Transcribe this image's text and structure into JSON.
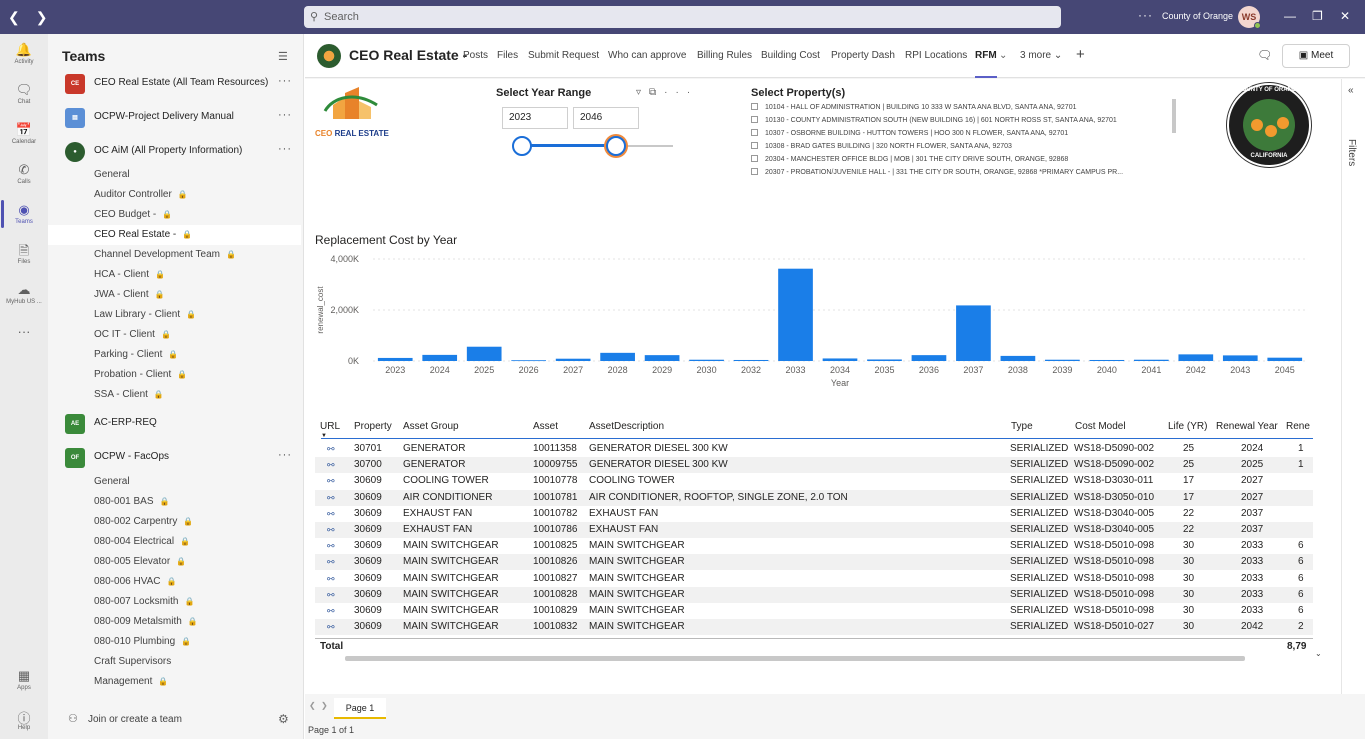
{
  "topbar": {
    "search_placeholder": "Search",
    "org": "County of Orange",
    "avatar_initials": "WS"
  },
  "rail": [
    {
      "label": "Activity",
      "icon": "bell-icon"
    },
    {
      "label": "Chat",
      "icon": "chat-icon"
    },
    {
      "label": "Calendar",
      "icon": "calendar-icon"
    },
    {
      "label": "Calls",
      "icon": "phone-icon"
    },
    {
      "label": "Teams",
      "icon": "teams-icon"
    },
    {
      "label": "Files",
      "icon": "file-icon"
    },
    {
      "label": "MyHub US ...",
      "icon": "cloud-icon"
    },
    {
      "label": "Apps",
      "icon": "apps-icon"
    },
    {
      "label": "Help",
      "icon": "help-icon"
    }
  ],
  "sidebar": {
    "title": "Teams",
    "teams": [
      {
        "name": "CEO Real Estate (All Team Resources)",
        "abbr": "CE",
        "color": "#c9382a"
      },
      {
        "name": "OCPW-Project Delivery Manual",
        "abbr": "",
        "color": "#5b8fd6"
      },
      {
        "name": "OC AiM (All Property Information)",
        "abbr": "",
        "color": "#2c5c2f"
      },
      {
        "name": "AC-ERP-REQ",
        "abbr": "AE",
        "color": "#3a8a3a"
      },
      {
        "name": "OCPW - FacOps",
        "abbr": "OF",
        "color": "#3a8a3a"
      }
    ],
    "channels_oc_aim": [
      "General",
      "Auditor Controller",
      "CEO Budget -",
      "CEO Real Estate -",
      "Channel Development Team",
      "HCA - Client",
      "JWA - Client",
      "Law Library - Client",
      "OC IT - Client",
      "Parking - Client",
      "Probation - Client",
      "SSA - Client"
    ],
    "channels_facops": [
      "General",
      "080-001 BAS",
      "080-002 Carpentry",
      "080-004 Electrical",
      "080-005 Elevator",
      "080-006 HVAC",
      "080-007 Locksmith",
      "080-009 Metalsmith",
      "080-010 Plumbing",
      "Craft Supervisors",
      "Management"
    ],
    "join_label": "Join or create a team"
  },
  "channel": {
    "name": "CEO Real Estate -",
    "tabs": [
      "Posts",
      "Files",
      "Submit Request",
      "Who can approve",
      "Billing Rules",
      "Building Cost",
      "Property Dash",
      "RPI Locations",
      "RFM",
      "3 more"
    ],
    "active_tab": "RFM",
    "meet_label": "Meet"
  },
  "report": {
    "logo_text_a": "CEO ",
    "logo_text_b": "REAL ESTATE",
    "year_title": "Select Year Range",
    "year_from": "2023",
    "year_to": "2046",
    "property_title": "Select Property(s)",
    "properties": [
      "10104 - HALL OF ADMINISTRATION | BUILDING 10 333 W SANTA ANA BLVD, SANTA ANA, 92701",
      "10130 - COUNTY ADMINISTRATION SOUTH (NEW BUILDING 16) | 601 NORTH ROSS ST, SANTA ANA, 92701",
      "10307 - OSBORNE BUILDING - HUTTON TOWERS | HOO 300 N FLOWER, SANTA ANA, 92701",
      "10308 - BRAD GATES BUILDING | 320 NORTH FLOWER, SANTA ANA, 92703",
      "20304 - MANCHESTER OFFICE BLDG | MOB | 301 THE CITY DRIVE SOUTH, ORANGE, 92868",
      "20307 - PROBATION/JUVENILE HALL - | 331 THE CITY DR SOUTH, ORANGE, 92868 *PRIMARY CAMPUS PR..."
    ],
    "seal_top": "COUNTY OF ORANGE",
    "seal_bottom": "CALIFORNIA",
    "filters_label": "Filters",
    "page_tab": "Page 1",
    "page_info": "Page 1 of 1"
  },
  "chart_data": {
    "type": "bar",
    "title": "Replacement Cost by Year",
    "xlabel": "Year",
    "ylabel": "renewal_cost",
    "y_ticks": [
      "0K",
      "2,000K",
      "4,000K"
    ],
    "ylim": [
      0,
      4000
    ],
    "color": "#1a7ee8",
    "categories": [
      "2023",
      "2024",
      "2025",
      "2026",
      "2027",
      "2028",
      "2029",
      "2030",
      "2032",
      "2033",
      "2034",
      "2035",
      "2036",
      "2037",
      "2038",
      "2039",
      "2040",
      "2041",
      "2042",
      "2043",
      "2045"
    ],
    "values": [
      120,
      240,
      560,
      30,
      90,
      320,
      230,
      50,
      40,
      3620,
      100,
      60,
      230,
      2180,
      200,
      50,
      40,
      50,
      260,
      220,
      130
    ]
  },
  "table": {
    "columns": [
      "URL",
      "Property",
      "Asset Group",
      "Asset",
      "AssetDescription",
      "Type",
      "Cost Model",
      "Life (YR)",
      "Renewal Year",
      "Rene"
    ],
    "rows": [
      [
        "30701",
        "GENERATOR",
        "10011358",
        "GENERATOR DIESEL 300 KW",
        "SERIALIZED",
        "WS18-D5090-002",
        "25",
        "2024",
        "1"
      ],
      [
        "30700",
        "GENERATOR",
        "10009755",
        "GENERATOR DIESEL 300 KW",
        "SERIALIZED",
        "WS18-D5090-002",
        "25",
        "2025",
        "1"
      ],
      [
        "30609",
        "COOLING TOWER",
        "10010778",
        "COOLING TOWER",
        "SERIALIZED",
        "WS18-D3030-011",
        "17",
        "2027",
        ""
      ],
      [
        "30609",
        "AIR CONDITIONER",
        "10010781",
        "AIR CONDITIONER, ROOFTOP, SINGLE ZONE, 2.0 TON",
        "SERIALIZED",
        "WS18-D3050-010",
        "17",
        "2027",
        ""
      ],
      [
        "30609",
        "EXHAUST FAN",
        "10010782",
        "EXHAUST FAN",
        "SERIALIZED",
        "WS18-D3040-005",
        "22",
        "2037",
        ""
      ],
      [
        "30609",
        "EXHAUST FAN",
        "10010786",
        "EXHAUST FAN",
        "SERIALIZED",
        "WS18-D3040-005",
        "22",
        "2037",
        ""
      ],
      [
        "30609",
        "MAIN SWITCHGEAR",
        "10010825",
        "MAIN SWITCHGEAR",
        "SERIALIZED",
        "WS18-D5010-098",
        "30",
        "2033",
        "6"
      ],
      [
        "30609",
        "MAIN SWITCHGEAR",
        "10010826",
        "MAIN SWITCHGEAR",
        "SERIALIZED",
        "WS18-D5010-098",
        "30",
        "2033",
        "6"
      ],
      [
        "30609",
        "MAIN SWITCHGEAR",
        "10010827",
        "MAIN SWITCHGEAR",
        "SERIALIZED",
        "WS18-D5010-098",
        "30",
        "2033",
        "6"
      ],
      [
        "30609",
        "MAIN SWITCHGEAR",
        "10010828",
        "MAIN SWITCHGEAR",
        "SERIALIZED",
        "WS18-D5010-098",
        "30",
        "2033",
        "6"
      ],
      [
        "30609",
        "MAIN SWITCHGEAR",
        "10010829",
        "MAIN SWITCHGEAR",
        "SERIALIZED",
        "WS18-D5010-098",
        "30",
        "2033",
        "6"
      ],
      [
        "30609",
        "MAIN SWITCHGEAR",
        "10010832",
        "MAIN SWITCHGEAR",
        "SERIALIZED",
        "WS18-D5010-027",
        "30",
        "2042",
        "2"
      ]
    ],
    "total_label": "Total",
    "total_value": "8,79"
  }
}
